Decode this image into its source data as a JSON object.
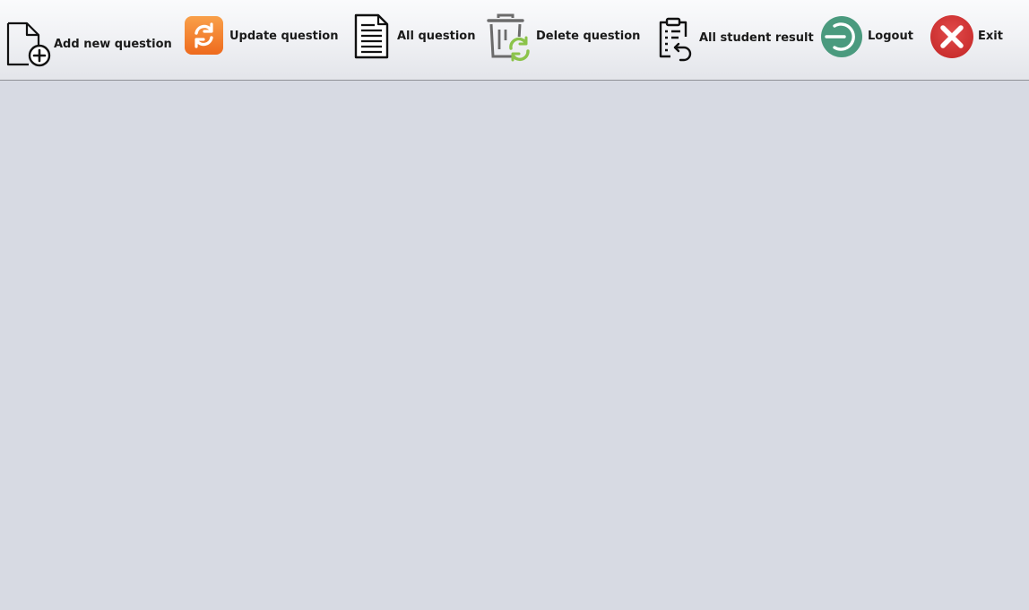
{
  "toolbar": {
    "buttons": [
      {
        "label": "Add new question",
        "icon": "add-document-icon"
      },
      {
        "label": "Update question",
        "icon": "refresh-icon",
        "color": "#f07a2a"
      },
      {
        "label": "All question",
        "icon": "document-list-icon"
      },
      {
        "label": "Delete question",
        "icon": "trash-refresh-icon",
        "color": "#8bc34a"
      },
      {
        "label": "All student result",
        "icon": "clipboard-undo-icon"
      },
      {
        "label": "Logout",
        "icon": "logout-icon",
        "color": "#4a9a7e"
      },
      {
        "label": "Exit",
        "icon": "close-circle-icon",
        "color": "#d33a3a"
      }
    ]
  },
  "colors": {
    "background": "#d7dae3",
    "toolbar_top": "#fafbfc",
    "toolbar_bottom": "#e3e5ea"
  }
}
